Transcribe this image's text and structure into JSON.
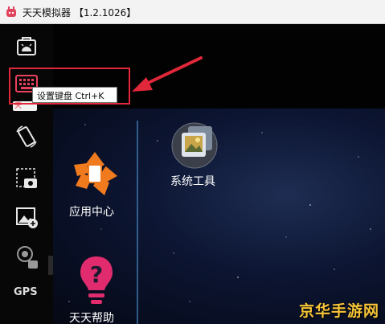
{
  "window": {
    "title": "天天模拟器 【1.2.1026】"
  },
  "sidebar": {
    "items": [
      {
        "icon": "android-bag-icon"
      },
      {
        "icon": "keyboard-icon",
        "badge": "天"
      },
      {
        "icon": "rotate-screen-icon"
      },
      {
        "icon": "screenshot-icon"
      },
      {
        "icon": "add-image-icon"
      },
      {
        "icon": "shake-icon"
      },
      {
        "label": "GPS"
      }
    ]
  },
  "tooltip": {
    "text": "设置键盘  Ctrl+K"
  },
  "desktop": {
    "apps": [
      {
        "label": "系统工具",
        "icon": "system-tools-folder-icon"
      },
      {
        "label": "应用中心",
        "icon": "app-center-icon"
      },
      {
        "label": "天天帮助",
        "icon": "help-icon"
      }
    ]
  },
  "watermark": {
    "text": "京华手游网"
  },
  "colors": {
    "highlight": "#e0283a",
    "accent": "#e8415e",
    "app_center_orange": "#f07a1e"
  }
}
